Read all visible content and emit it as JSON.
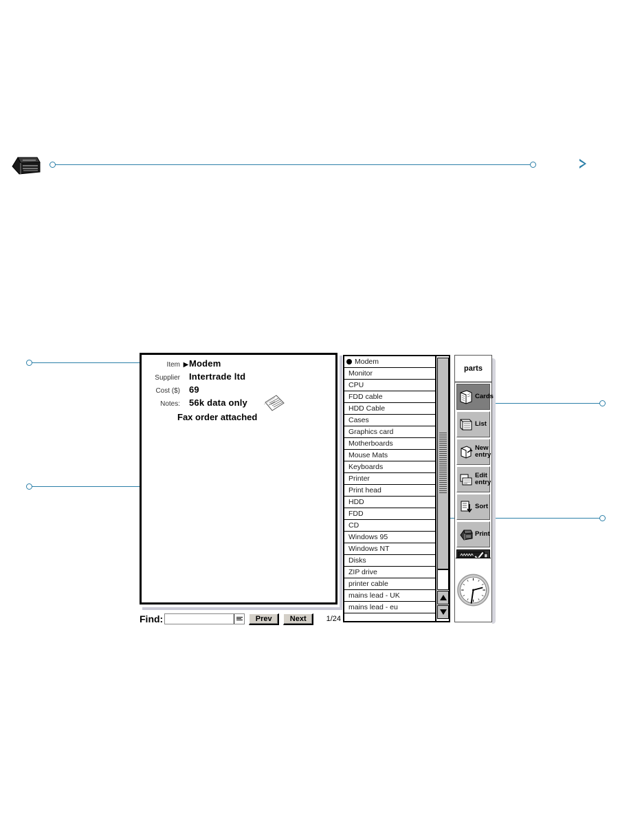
{
  "decor": {
    "accent_color": "#2b7fa8",
    "printer_icon": "printer-icon",
    "next_page_arrow": "triangle-right-icon"
  },
  "card": {
    "fields": [
      {
        "label": "Item",
        "value": "Modem",
        "arrow": "▶",
        "has_arrow": true
      },
      {
        "label": "Supplier",
        "value": "Intertrade ltd",
        "arrow": "",
        "has_arrow": false
      },
      {
        "label": "Cost ($)",
        "value": "69",
        "arrow": "",
        "has_arrow": false
      },
      {
        "label": "Notes:",
        "value": "56k data only",
        "arrow": "",
        "has_arrow": false
      }
    ],
    "note": "Fax order attached",
    "attachment_icon": "fax-document-icon"
  },
  "find_bar": {
    "label": "Find:",
    "input_value": "",
    "input_placeholder": "",
    "menu_icon": "list-lines-icon",
    "prev_label": "Prev",
    "next_label": "Next",
    "record_counter": "1/24"
  },
  "list": {
    "selected_index": 0,
    "items": [
      "Modem",
      "Monitor",
      "CPU",
      "FDD cable",
      "HDD Cable",
      "Cases",
      "Graphics card",
      "Motherboards",
      "Mouse Mats",
      "Keyboards",
      "Printer",
      "Print head",
      "HDD",
      "FDD",
      "CD",
      "Windows 95",
      "Windows NT",
      "Disks",
      "ZIP drive",
      "printer cable",
      "mains lead - UK",
      "mains lead - eu"
    ],
    "scrollbar": {
      "up_arrow_icon": "triangle-up-icon",
      "down_arrow_icon": "triangle-down-icon",
      "grip_icon": "scroll-grip-icon"
    }
  },
  "toolbar": {
    "database_tab": "parts",
    "buttons": [
      {
        "label": "Cards",
        "icon": "cards-icon",
        "active": true
      },
      {
        "label": "List",
        "icon": "list-stack-icon",
        "active": false
      },
      {
        "label": "New entry",
        "icon": "new-entry-icon",
        "active": false
      },
      {
        "label": "Edit entry",
        "icon": "edit-entry-icon",
        "active": false
      },
      {
        "label": "Sort",
        "icon": "sort-icon",
        "active": false
      },
      {
        "label": "Print",
        "icon": "printer-icon",
        "active": false
      }
    ],
    "battery_icon": "battery-check-icon",
    "clock_icon": "analog-clock-icon"
  }
}
